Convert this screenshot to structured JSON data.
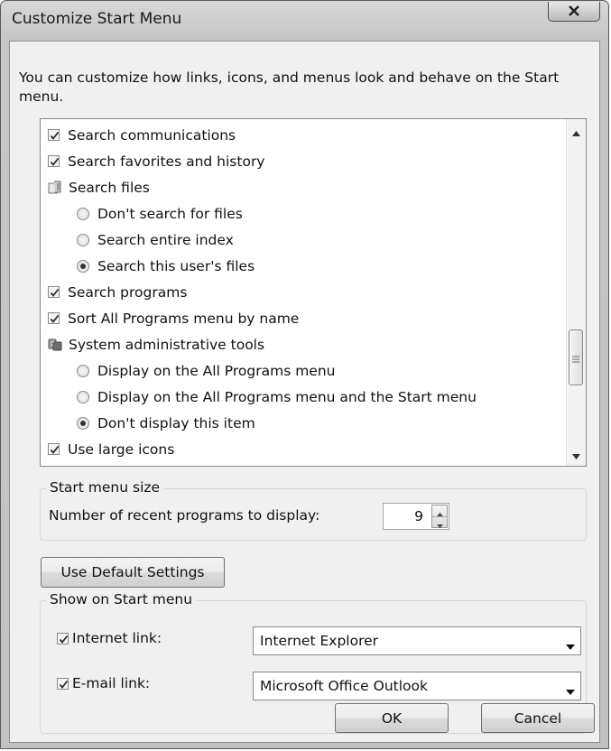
{
  "window": {
    "title": "Customize Start Menu"
  },
  "intro_text": "You can customize how links, icons, and menus look and behave on the Start menu.",
  "options": [
    {
      "type": "checkbox",
      "label": "Search communications",
      "checked": true,
      "level": 0
    },
    {
      "type": "checkbox",
      "label": "Search favorites and history",
      "checked": true,
      "level": 0
    },
    {
      "type": "group",
      "label": "Search files",
      "icon": "files-icon",
      "level": 0
    },
    {
      "type": "radio",
      "label": "Don't search for files",
      "checked": false,
      "level": 1
    },
    {
      "type": "radio",
      "label": "Search entire index",
      "checked": false,
      "level": 1
    },
    {
      "type": "radio",
      "label": "Search this user's files",
      "checked": true,
      "level": 1
    },
    {
      "type": "checkbox",
      "label": "Search programs",
      "checked": true,
      "level": 0
    },
    {
      "type": "checkbox",
      "label": "Sort All Programs menu by name",
      "checked": true,
      "level": 0
    },
    {
      "type": "group",
      "label": "System administrative tools",
      "icon": "admin-tools-icon",
      "level": 0
    },
    {
      "type": "radio",
      "label": "Display on the All Programs menu",
      "checked": false,
      "level": 1
    },
    {
      "type": "radio",
      "label": "Display on the All Programs menu and the Start menu",
      "checked": false,
      "level": 1
    },
    {
      "type": "radio",
      "label": "Don't display this item",
      "checked": true,
      "level": 1
    },
    {
      "type": "checkbox",
      "label": "Use large icons",
      "checked": true,
      "level": 0
    }
  ],
  "start_menu_size": {
    "title": "Start menu size",
    "recent_label": "Number of recent programs to display:",
    "recent_value": "9"
  },
  "default_button": "Use Default Settings",
  "show_on_start_menu": {
    "title": "Show on Start menu",
    "internet_label": "Internet link:",
    "internet_checked": true,
    "internet_value": "Internet Explorer",
    "email_label": "E-mail link:",
    "email_checked": true,
    "email_value": "Microsoft Office Outlook"
  },
  "buttons": {
    "ok": "OK",
    "cancel": "Cancel"
  }
}
